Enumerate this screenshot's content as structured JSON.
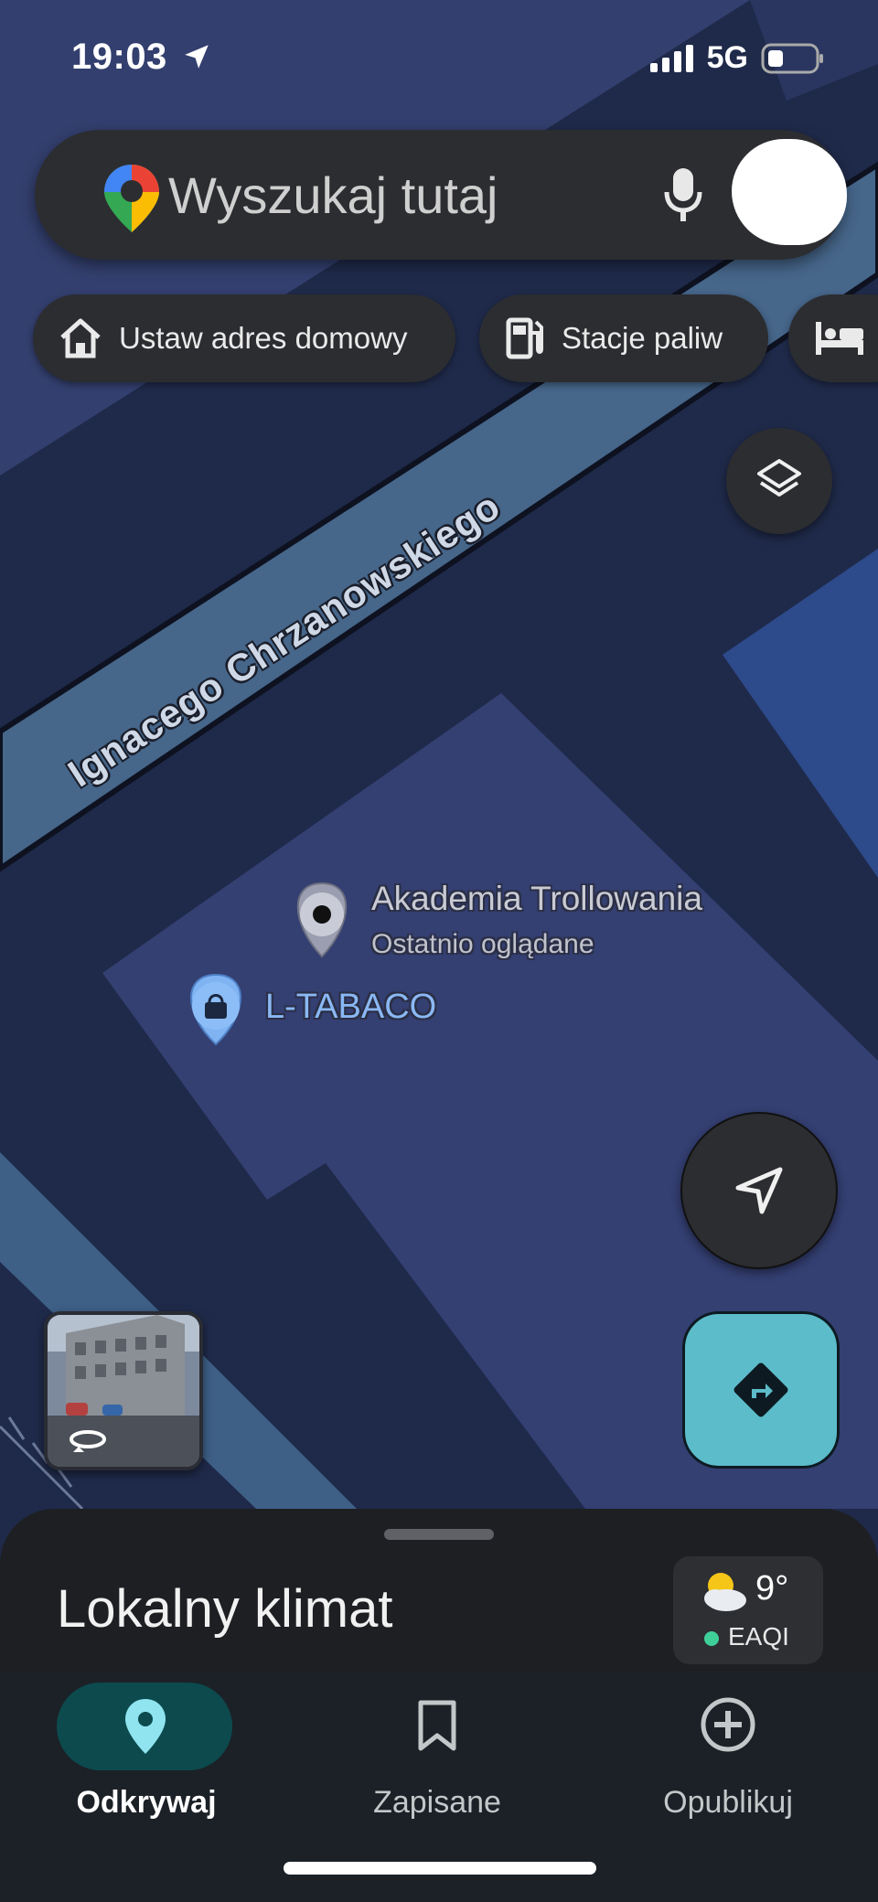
{
  "status_bar": {
    "time": "19:03",
    "network": "5G",
    "icons": [
      "location-arrow-icon",
      "signal-icon",
      "battery-icon"
    ]
  },
  "search": {
    "placeholder": "Wyszukaj tutaj",
    "icons": [
      "google-maps-pin-icon",
      "microphone-icon",
      "avatar"
    ]
  },
  "chips": [
    {
      "label": "Ustaw adres domowy",
      "icon": "home-icon"
    },
    {
      "label": "Stacje paliw",
      "icon": "fuel-icon"
    },
    {
      "label": "",
      "icon": "hotel-bed-icon"
    }
  ],
  "map": {
    "street": "Ignacego Chrzanowskiego",
    "places": [
      {
        "name": "Akademia Trollowania",
        "subtitle": "Ostatnio oglądane",
        "icon": "recent-place-pin-icon"
      },
      {
        "name": "L-TABACO",
        "icon": "shopping-bag-pin-icon"
      }
    ]
  },
  "controls": [
    "layers-icon",
    "navigation-arrow-icon",
    "directions-icon",
    "street-view-rotate-icon"
  ],
  "bottom_sheet": {
    "title": "Lokalny klimat",
    "weather": {
      "temperature": "9°",
      "aqi": "EAQI",
      "icon": "partly-cloudy-icon"
    }
  },
  "nav": {
    "items": [
      {
        "label": "Odkrywaj",
        "icon": "location-pin-icon",
        "active": true
      },
      {
        "label": "Zapisane",
        "icon": "bookmark-icon",
        "active": false
      },
      {
        "label": "Opublikuj",
        "icon": "add-circle-icon",
        "active": false
      }
    ]
  },
  "colors": {
    "map_background": "#1f2a4a",
    "block": "#333f6e",
    "road": "#46668a",
    "accent": "#5cbcc9",
    "active_nav": "#8fe4ef",
    "active_pill": "#0c4a4e"
  }
}
